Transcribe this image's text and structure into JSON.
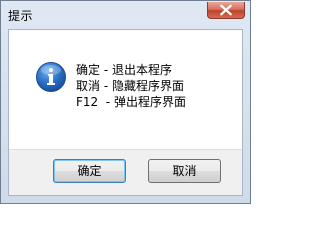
{
  "window": {
    "title": "提示"
  },
  "message": {
    "lines": [
      "确定 - 退出本程序",
      "取消 - 隐藏程序界面",
      "F12  - 弹出程序界面"
    ]
  },
  "icons": {
    "close": "close-icon",
    "info": "info-icon"
  },
  "buttons": {
    "ok_label": "确定",
    "cancel_label": "取消"
  },
  "colors": {
    "close_button": "#c8432d",
    "info_icon": "#1f63b6",
    "default_button_border": "#3c7fb1"
  }
}
